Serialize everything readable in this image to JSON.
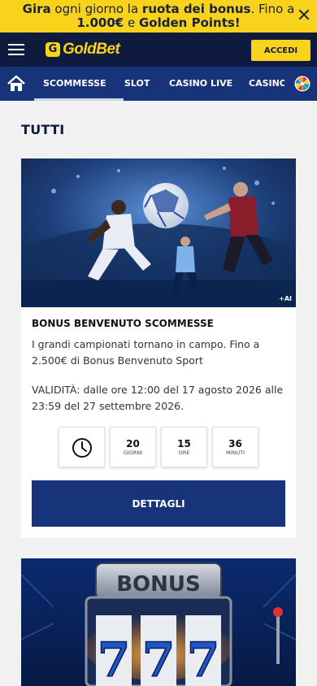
{
  "promo": {
    "part1": "Gira",
    "part2": " ogni giorno la ",
    "part3": "ruota dei bonus",
    "part4": ". Fino a",
    "part5": "1.000€",
    "part6": " e ",
    "part7": "Golden Points!"
  },
  "header": {
    "logo": "GoldBet",
    "logo_mark": "G",
    "login_label": "ACCEDI"
  },
  "nav": {
    "items": [
      "SCOMMESSE",
      "SLOT",
      "CASINO LIVE",
      "CASINO"
    ]
  },
  "section": {
    "title": "TUTTI"
  },
  "card1": {
    "ai_tag": "+AI",
    "title": "BONUS BENVENUTO SCOMMESSE",
    "description": "I grandi campionati tornano in campo. Fino a 2.500€ di Bonus Benvenuto Sport",
    "validity": "VALIDITÀ: dalle ore 12:00 del 17 agosto 2026 alle 23:59 del 27 settembre 2026.",
    "countdown": {
      "days": "20",
      "days_label": "GIORNI",
      "hours": "15",
      "hours_label": "ORE",
      "minutes": "36",
      "minutes_label": "MINUTI"
    },
    "button_label": "DETTAGLI"
  },
  "card2": {
    "image_text": "BONUS",
    "reel_symbol": "7"
  },
  "colors": {
    "brand_yellow": "#f9d21b",
    "header_navy": "#0f1b3e",
    "nav_blue": "#17337a"
  }
}
